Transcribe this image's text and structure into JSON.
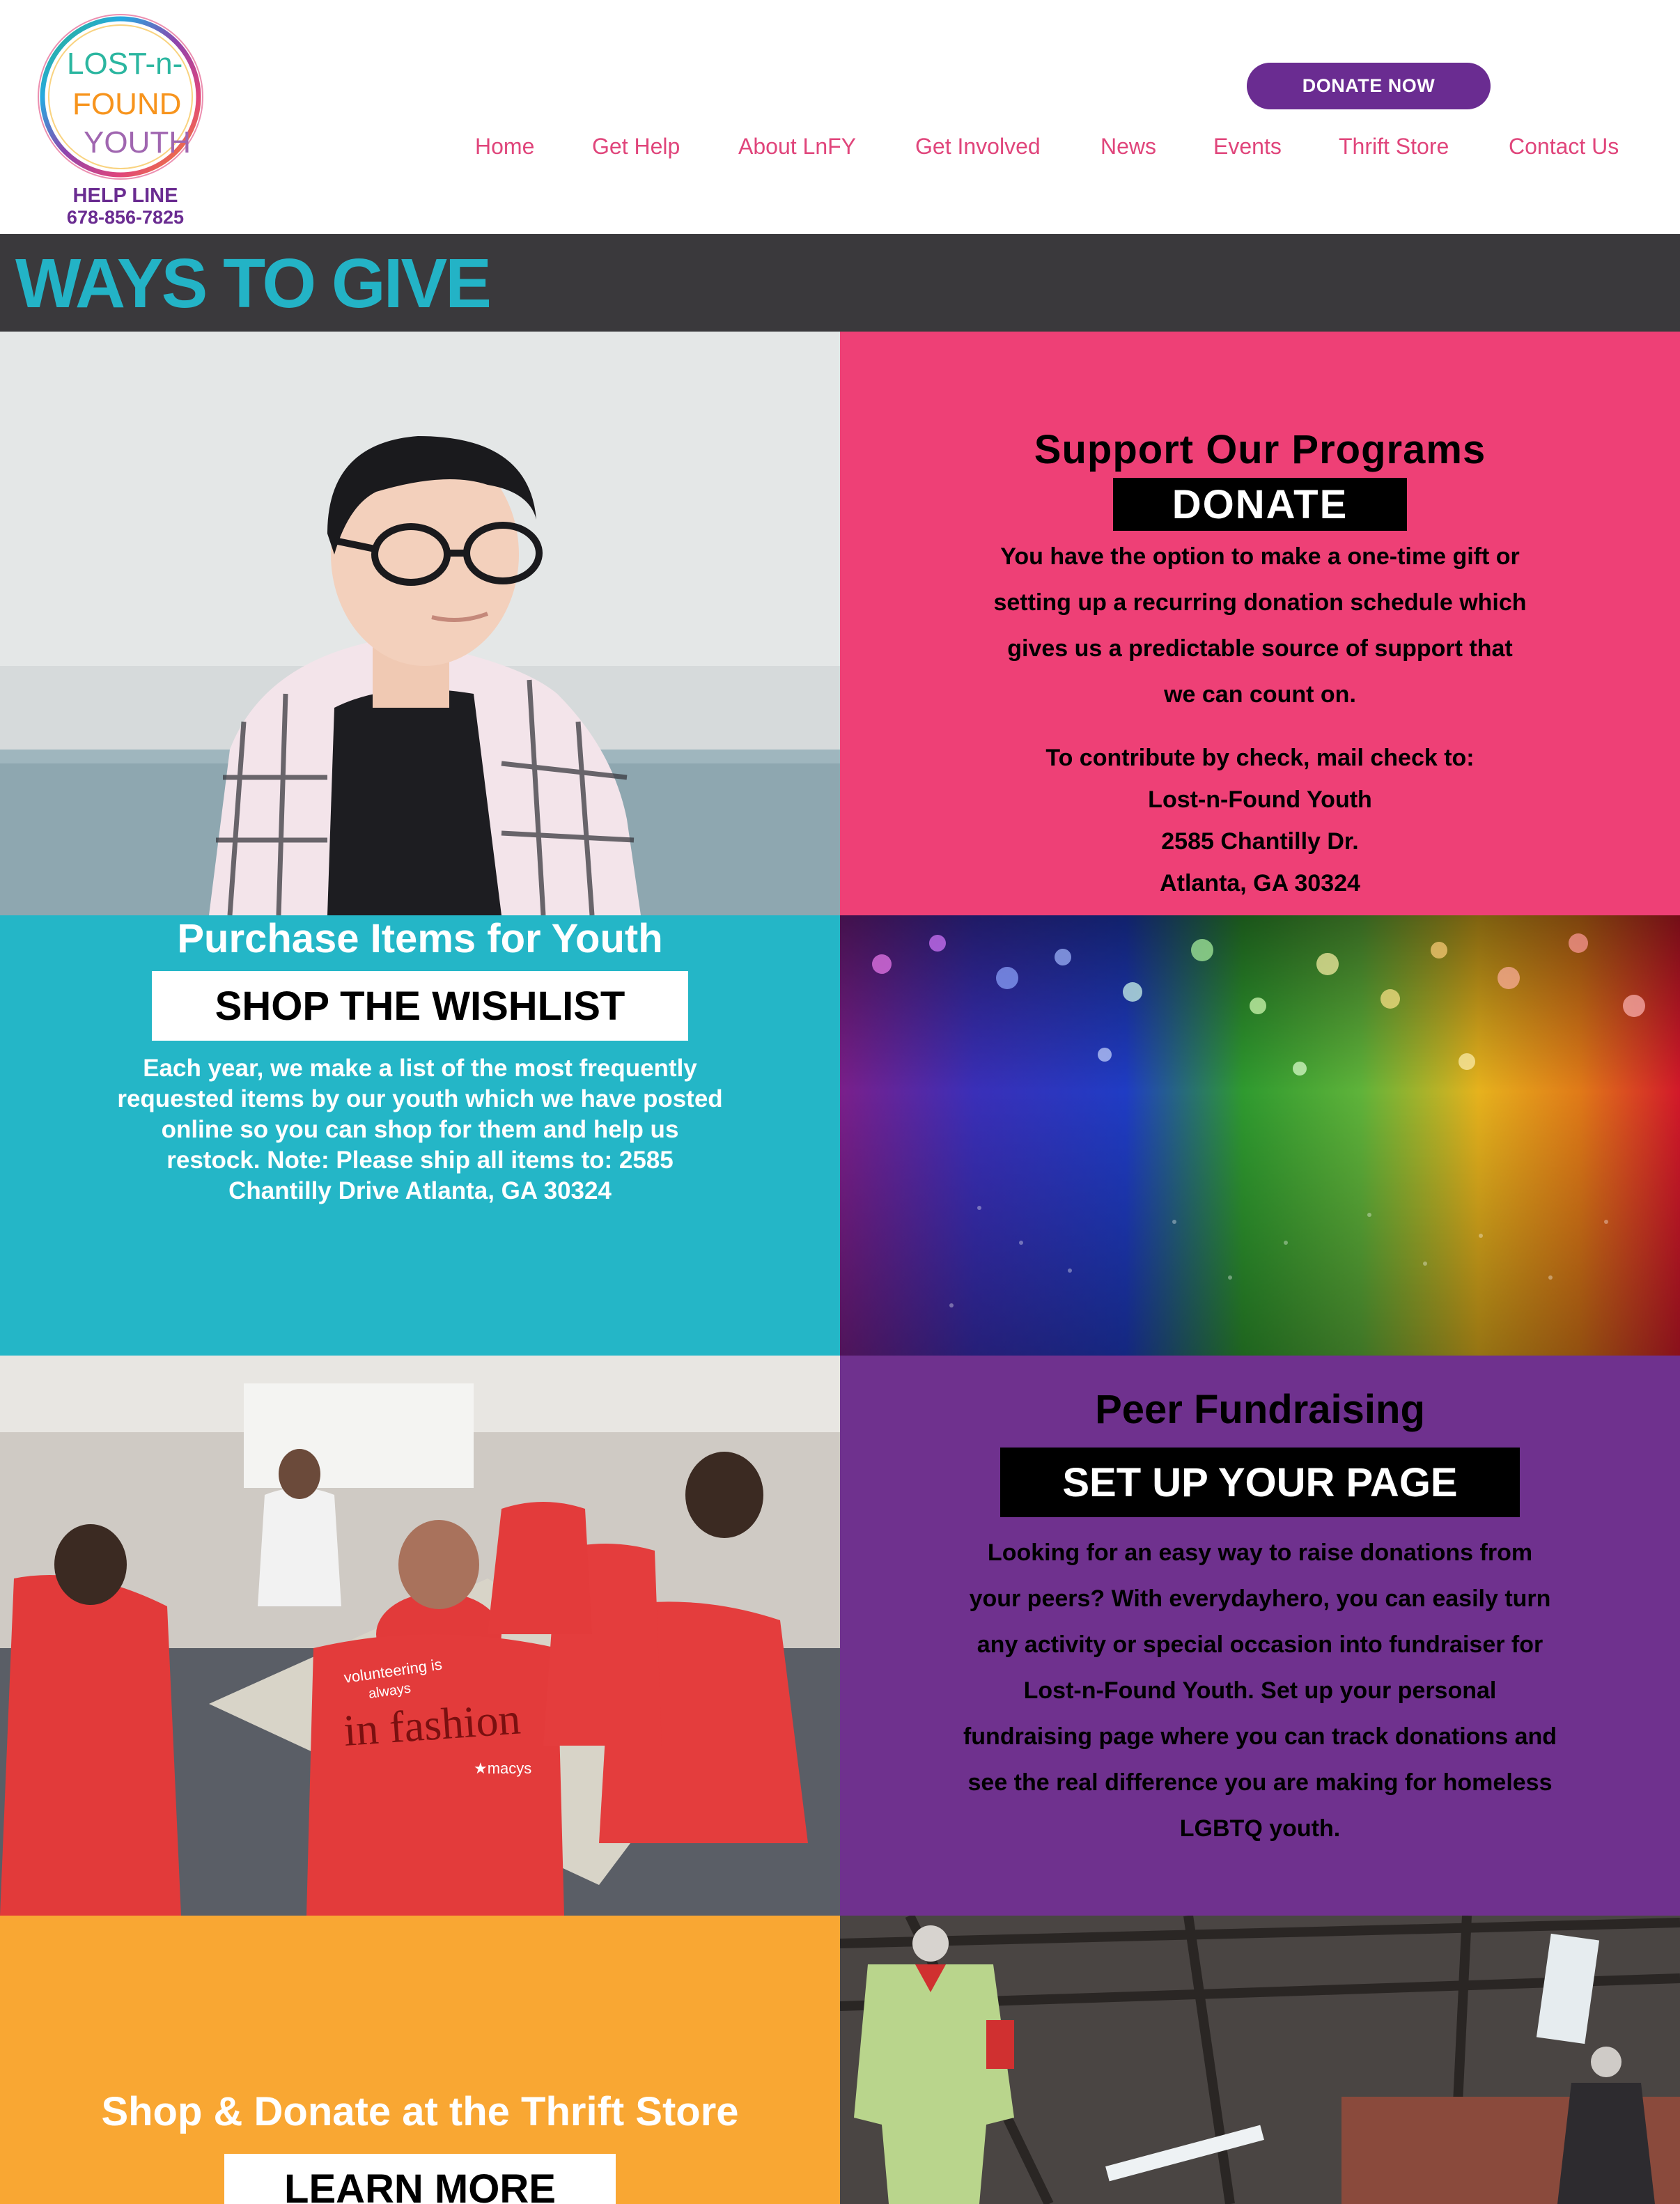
{
  "header": {
    "logo": {
      "line1": "LOST-n-",
      "line2": "FOUND",
      "line3": "YOUTH"
    },
    "helpline_title": "HELP LINE",
    "helpline_phone": "678-856-7825",
    "donate_now_label": "DONATE NOW",
    "nav": [
      {
        "label": "Home"
      },
      {
        "label": "Get Help"
      },
      {
        "label": "About LnFY"
      },
      {
        "label": "Get Involved"
      },
      {
        "label": "News"
      },
      {
        "label": "Events"
      },
      {
        "label": "Thrift Store"
      },
      {
        "label": "Contact Us"
      }
    ]
  },
  "page_title": "WAYS TO GIVE",
  "programs": {
    "title": "Support Our Programs",
    "button_label": "DONATE",
    "body_lines": [
      "You have the option to make a one-time gift or",
      "setting up a recurring donation schedule which",
      "gives us a predictable source of support that",
      "we can count on."
    ],
    "check_lines": [
      "To contribute by check, mail check to:",
      "Lost-n-Found Youth",
      "2585 Chantilly Dr.",
      "Atlanta, GA 30324"
    ]
  },
  "wishlist": {
    "title": "Purchase Items for Youth",
    "button_label": "SHOP THE WISHLIST",
    "body_lines": [
      "Each year, we make a list of the most frequently",
      "requested items by our youth which we have posted",
      "online so you can shop for them and help us",
      "restock. Note: Please ship all items to: 2585",
      "Chantilly Drive Atlanta, GA 30324"
    ]
  },
  "peer": {
    "title": "Peer Fundraising",
    "button_label": "SET UP YOUR PAGE",
    "body_lines": [
      "Looking for an easy way to raise donations from",
      "your peers? With everydayhero, you can easily turn",
      "any activity or special occasion into fundraiser for",
      "Lost-n-Found Youth. Set up your personal",
      "fundraising page where you can track donations and",
      "see the real difference you are making for homeless",
      "LGBTQ youth."
    ]
  },
  "thrift": {
    "title": "Shop & Donate at the Thrift Store",
    "button_label": "LEARN MORE"
  },
  "photo_text": {
    "shirt_line1": "volunteering is",
    "shirt_line2": "always",
    "shirt_main": "in fashion",
    "shirt_brand": "★macys"
  },
  "colors": {
    "purple": "#6a2c91",
    "nav_pink": "#e0457b",
    "panel_pink": "#ee4076",
    "teal": "#24b6c7",
    "panel_purple": "#6f318e",
    "orange": "#f9a733",
    "title_bar": "#3a393c"
  }
}
